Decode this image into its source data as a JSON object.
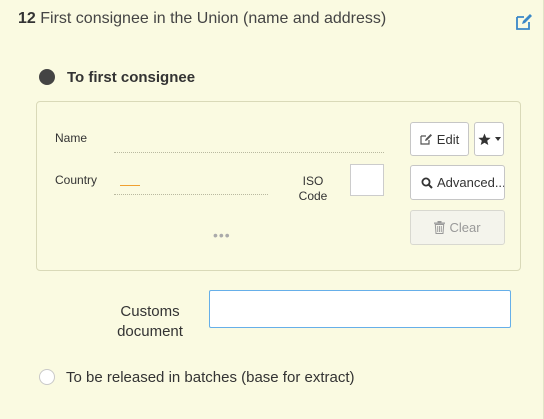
{
  "section": {
    "number": "12",
    "title": "First consignee in the Union (name and address)"
  },
  "option_first": {
    "label": "To first consignee",
    "selected": true
  },
  "consignee": {
    "name_label": "Name",
    "country_label": "Country",
    "iso_label_line1": "ISO",
    "iso_label_line2": "Code",
    "more": "•••"
  },
  "buttons": {
    "edit": "Edit",
    "advanced": "Advanced...",
    "clear": "Clear"
  },
  "customs": {
    "label_line1": "Customs",
    "label_line2": "document",
    "value": ""
  },
  "option_batches": {
    "label": "To be released in batches (base for extract)",
    "selected": false
  },
  "colors": {
    "panel_background": "#fafae1",
    "accent_blue": "#3a87c8",
    "focus_border": "#66afe9"
  },
  "icons": [
    "edit-pencil-icon",
    "edit-icon",
    "star-icon",
    "caret-down-icon",
    "search-icon",
    "trash-icon"
  ]
}
